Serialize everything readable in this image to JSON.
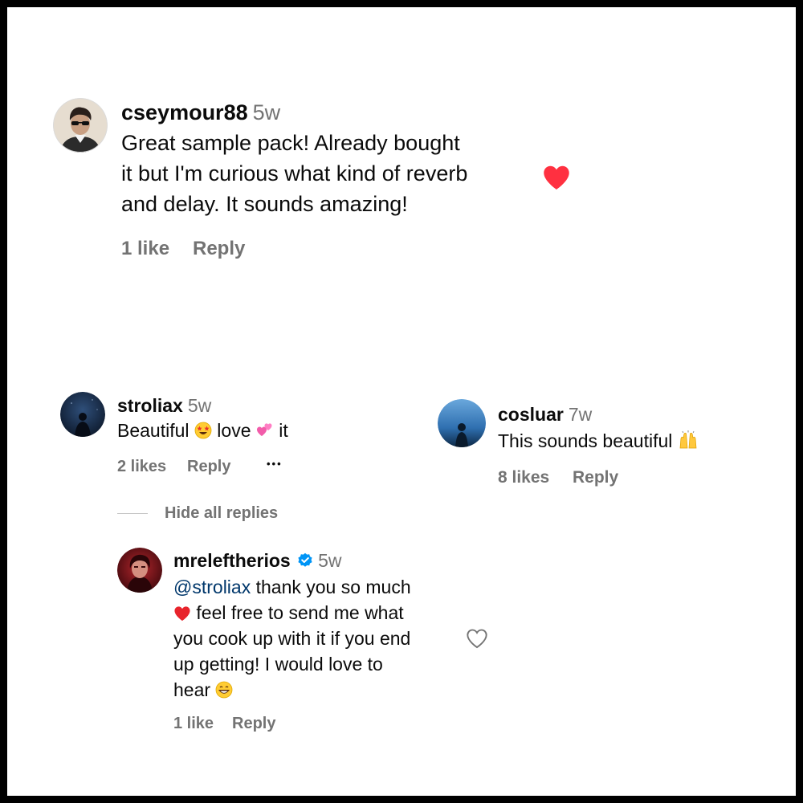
{
  "comments": [
    {
      "username": "cseymour88",
      "time": "5w",
      "lines": [
        "Great sample pack! Already bought",
        "it but I'm curious what kind of reverb",
        "and delay. It sounds amazing!"
      ],
      "likes": "1 like",
      "reply": "Reply",
      "liked": true,
      "like_color": "#ff3040",
      "avatar_icon": "person-with-sunglasses-avatar"
    },
    {
      "username": "stroliax",
      "time": "5w",
      "text_parts": [
        "Beautiful",
        "love",
        "it"
      ],
      "emojis": [
        "star-struck-emoji",
        "two-hearts-emoji"
      ],
      "likes": "2 likes",
      "reply": "Reply",
      "more": "•••",
      "hide_replies": "Hide all replies",
      "avatar_icon": "dark-blue-silhouette-avatar"
    },
    {
      "username": "cosluar",
      "time": "7w",
      "text": "This sounds beautiful",
      "emoji": "raising-hands-emoji",
      "likes": "8 likes",
      "reply": "Reply",
      "avatar_icon": "blue-sky-silhouette-avatar"
    },
    {
      "username": "mreleftherios",
      "verified": true,
      "time": "5w",
      "mention": "@stroliax",
      "lines": [
        " thank you so much",
        " feel free to send me what",
        "you cook up with it if you end",
        "up getting! I would love to",
        "hear"
      ],
      "emojis": [
        "red-heart-emoji",
        "grinning-face-emoji"
      ],
      "likes": "1 like",
      "reply": "Reply",
      "liked": false,
      "avatar_icon": "red-portrait-avatar"
    }
  ],
  "colors": {
    "text": "#0b0b0b",
    "secondary": "#737373",
    "mention": "#00376b",
    "verified": "#0095f6",
    "liked_heart": "#ff3040"
  }
}
